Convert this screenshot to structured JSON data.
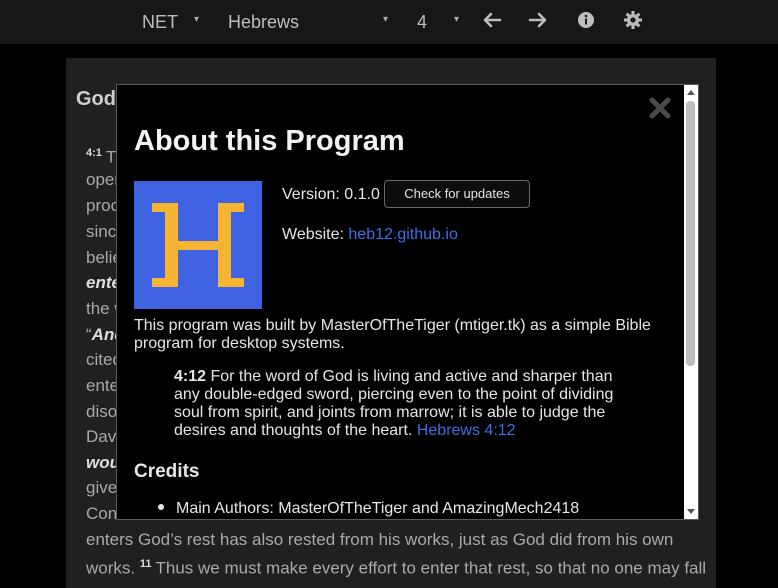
{
  "toolbar": {
    "translation": "NET",
    "book": "Hebrews",
    "chapter": "4",
    "caret": "▾"
  },
  "article": {
    "title_partial": "God",
    "lines": [
      {
        "vnum": "4:1",
        "text": "Th"
      },
      {
        "text": "open"
      },
      {
        "text": "procla"
      },
      {
        "text": "since"
      },
      {
        "text": "believ"
      },
      {
        "em": "enter"
      },
      {
        "text": "the w"
      },
      {
        "text": "“",
        "em": "And"
      },
      {
        "text": "cited"
      },
      {
        "text": "enter"
      },
      {
        "text": "disob"
      },
      {
        "text": "David"
      },
      {
        "em": "woul"
      },
      {
        "text": "given"
      },
      {
        "text": "Cons"
      },
      {
        "text": "enters God’s rest has also rested from his works, just as God did from his own"
      },
      {
        "text": "works.",
        "vnum2": "11",
        "text2": "Thus we must make every effort to enter that rest, so that no one may fall"
      }
    ]
  },
  "modal": {
    "title": "About this Program",
    "version_label": "Version: 0.1.0",
    "update_button": "Check for updates",
    "website_label": "Website:",
    "website_link": "heb12.github.io",
    "description": "This program was built by MasterOfTheTiger (mtiger.tk) as a simple Bible program for desktop systems.",
    "verse_ref": "4:12",
    "verse_text": "For the word of God is living and active and sharper than any double-edged sword, piercing even to the point of dividing soul from spirit, and joints from marrow; it is able to judge the desires and thoughts of the heart.",
    "verse_link": "Hebrews 4:12",
    "credits_heading": "Credits",
    "authors": "Main Authors: MasterOfTheTiger and AmazingMech2418",
    "logo_letter": "H"
  },
  "colors": {
    "accent": "#3f62e3",
    "logo_letter": "#f5b431",
    "link": "#3e6fe8"
  }
}
